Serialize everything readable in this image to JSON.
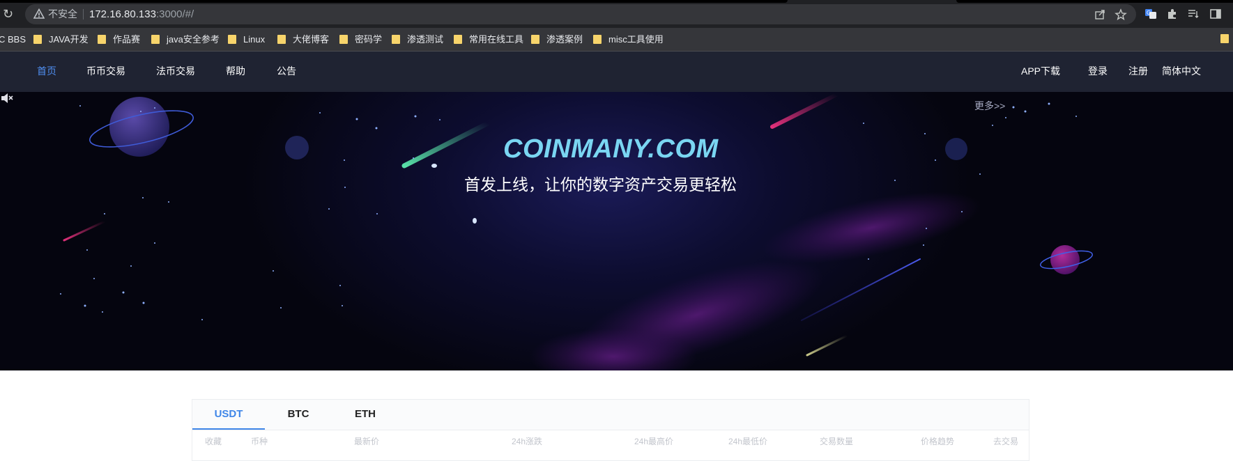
{
  "browser": {
    "insecure_label": "不安全",
    "url_host": "172.16.80.133",
    "url_path": ":3000/#/",
    "bookmarks": [
      "C BBS",
      "JAVA开发",
      "作品赛",
      "java安全参考",
      "Linux",
      "大佬博客",
      "密码学",
      "渗透测试",
      "常用在线工具",
      "渗透案例",
      "misc工具使用"
    ]
  },
  "nav": {
    "left": [
      "首页",
      "币币交易",
      "法币交易",
      "帮助",
      "公告"
    ],
    "right": [
      "APP下载",
      "登录",
      "注册",
      "简体中文"
    ],
    "active": "首页",
    "accent_color": "#4f8ef0",
    "background": "#1f2332"
  },
  "banner": {
    "brand": "COINMANY.COM",
    "slogan": "首发上线，让你的数字资产交易更轻松",
    "more": "更多>>",
    "mute_icon": "speaker-mute-icon"
  },
  "market": {
    "tabs": [
      "USDT",
      "BTC",
      "ETH"
    ],
    "active_tab": "USDT",
    "columns": [
      "收藏",
      "币种",
      "最新价",
      "24h涨跌",
      "24h最高价",
      "24h最低价",
      "交易数量",
      "价格趋势",
      "去交易"
    ]
  }
}
